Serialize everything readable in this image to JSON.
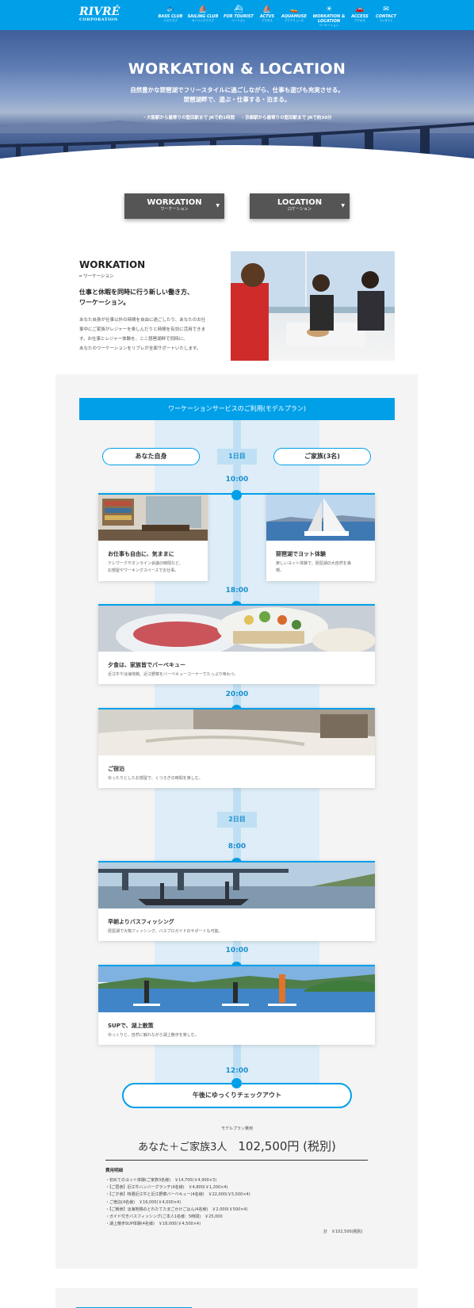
{
  "header": {
    "logo": "RIVRÉ",
    "logo_sub": "CORPORATION",
    "nav": [
      {
        "en": "BASS CLUB",
        "jp": "バスクラブ",
        "icon": "fish-icon",
        "glyph": "🐟"
      },
      {
        "en": "SAILING CLUB",
        "jp": "セーリングクラブ",
        "icon": "sailboat-icon",
        "glyph": "⛵"
      },
      {
        "en": "FOR TOURIST",
        "jp": "ツーリスト",
        "icon": "boat-icon",
        "glyph": "⛴"
      },
      {
        "en": "ACTVS",
        "jp": "アクタス",
        "icon": "sail-icon",
        "glyph": "⛵"
      },
      {
        "en": "AQUAMUSE",
        "jp": "アクアミューズ",
        "icon": "waterbike-icon",
        "glyph": "🚤"
      },
      {
        "en": "WORKATION & LOCATION",
        "jp": "ワーケーション",
        "icon": "sun-icon",
        "glyph": "☀"
      },
      {
        "en": "ACCESS",
        "jp": "アクセス",
        "icon": "car-icon",
        "glyph": "🚗"
      },
      {
        "en": "CONTACT",
        "jp": "コンタクト",
        "icon": "mail-icon",
        "glyph": "✉"
      }
    ]
  },
  "hero": {
    "title": "WORKATION & LOCATION",
    "sub1": "自然豊かな琵琶湖でフリースタイルに過ごしながら、仕事も遊びも充実させる。",
    "sub2": "琵琶湖畔で、遊ぶ・仕事する・泊まる。",
    "access1": "・大阪駅から最寄りの堅田駅まで JRで約1時間",
    "access2": "・京都駅から最寄りの堅田駅まで JRで約30分"
  },
  "tabs": [
    {
      "en": "WORKATION",
      "jp": "ワーケーション"
    },
    {
      "en": "LOCATION",
      "jp": "ロケーション"
    }
  ],
  "intro": {
    "title": "WORKATION",
    "sub": "ワーケーション",
    "heading1": "仕事と休暇を同時に行う新しい働き方、",
    "heading2": "ワーケーション。",
    "body": [
      "あなた自身が仕事以外の時間を自由に過ごしたり、あなたのお仕",
      "事中にご家族がレジャーを楽しんだりと時間を有効に活用できま",
      "す。お仕事とレジャー体験を、ここ琵琶湖畔で同時に。",
      "あなたのワーケーションをリブレが全面サポートいたします。"
    ]
  },
  "plan": {
    "bar": "ワーケーションサービスのご利用(モデルプラン)",
    "you": "あなた自身",
    "family": "ご家族(3名)",
    "day1": "1日目",
    "day2": "2日目",
    "times": [
      "10:00",
      "18:00",
      "20:00",
      "8:00",
      "10:00",
      "12:00"
    ],
    "cards": [
      {
        "title": "お仕事も自由に、気ままに",
        "d1": "テレワークやオンライン会議の時間など、",
        "d2": "お部屋やワーキングスペースでお仕事。"
      },
      {
        "title": "琵琶湖でヨット体験",
        "d1": "楽しいヨット体験で、琵琶湖の大自然を満",
        "d2": "喫。"
      },
      {
        "title": "夕食は、家族皆でバーベキュー",
        "d1": "近江牛や淡海地鶏、近江野菜をバーベキューコーナーでたっぷり味わう。",
        "d2": ""
      },
      {
        "title": "ご宿泊",
        "d1": "ゆったりとしたお部屋で、くつろぎの時間を楽しむ。",
        "d2": ""
      },
      {
        "title": "早朝よりバスフィッシング",
        "d1": "琵琶湖で大物フィッシング。バスプロガイドのサポートも可能。",
        "d2": ""
      },
      {
        "title": "SUPで、湖上散策",
        "d1": "ゆっくりと、自然に触れながら湖上散歩を楽しむ。",
        "d2": ""
      }
    ],
    "checkout": "午後にゆっくりチェックアウト"
  },
  "fee": {
    "label": "モデルプラン費用",
    "who": "あなた＋ご家族3人",
    "amount": "102,500円 (税別)",
    "breakdown_title": "費用明細",
    "items": [
      "・初めてのヨット体験(ご家族3名様)　￥14,700(￥4,900×3)",
      "・【ご昼食】近江牛ハンバーグランチ(4名様)　￥4,800(￥1,200×4)",
      "・【ご夕食】特選近江牛と近江野菜バーベキュー(4名様)　￥22,000(￥5,500×4)",
      "・ご宿泊(4名様)　￥16,000(￥4,000×4)",
      "・【ご朝食】淡海地鶏のとれたてたまごかけごはん(4名様)　￥2,000(￥500×4)",
      "・ガイド付きバスフィッシング(ご本人1名様：5時間)　￥25,000",
      "・湖上散歩SUP体験(4名様)　￥18,000(￥4,500×4)"
    ],
    "total": "計　￥102,500(税別)"
  },
  "colors": {
    "accent": "#00a0e9",
    "tab_bg": "#555555",
    "panel": "#f4f4f4"
  }
}
